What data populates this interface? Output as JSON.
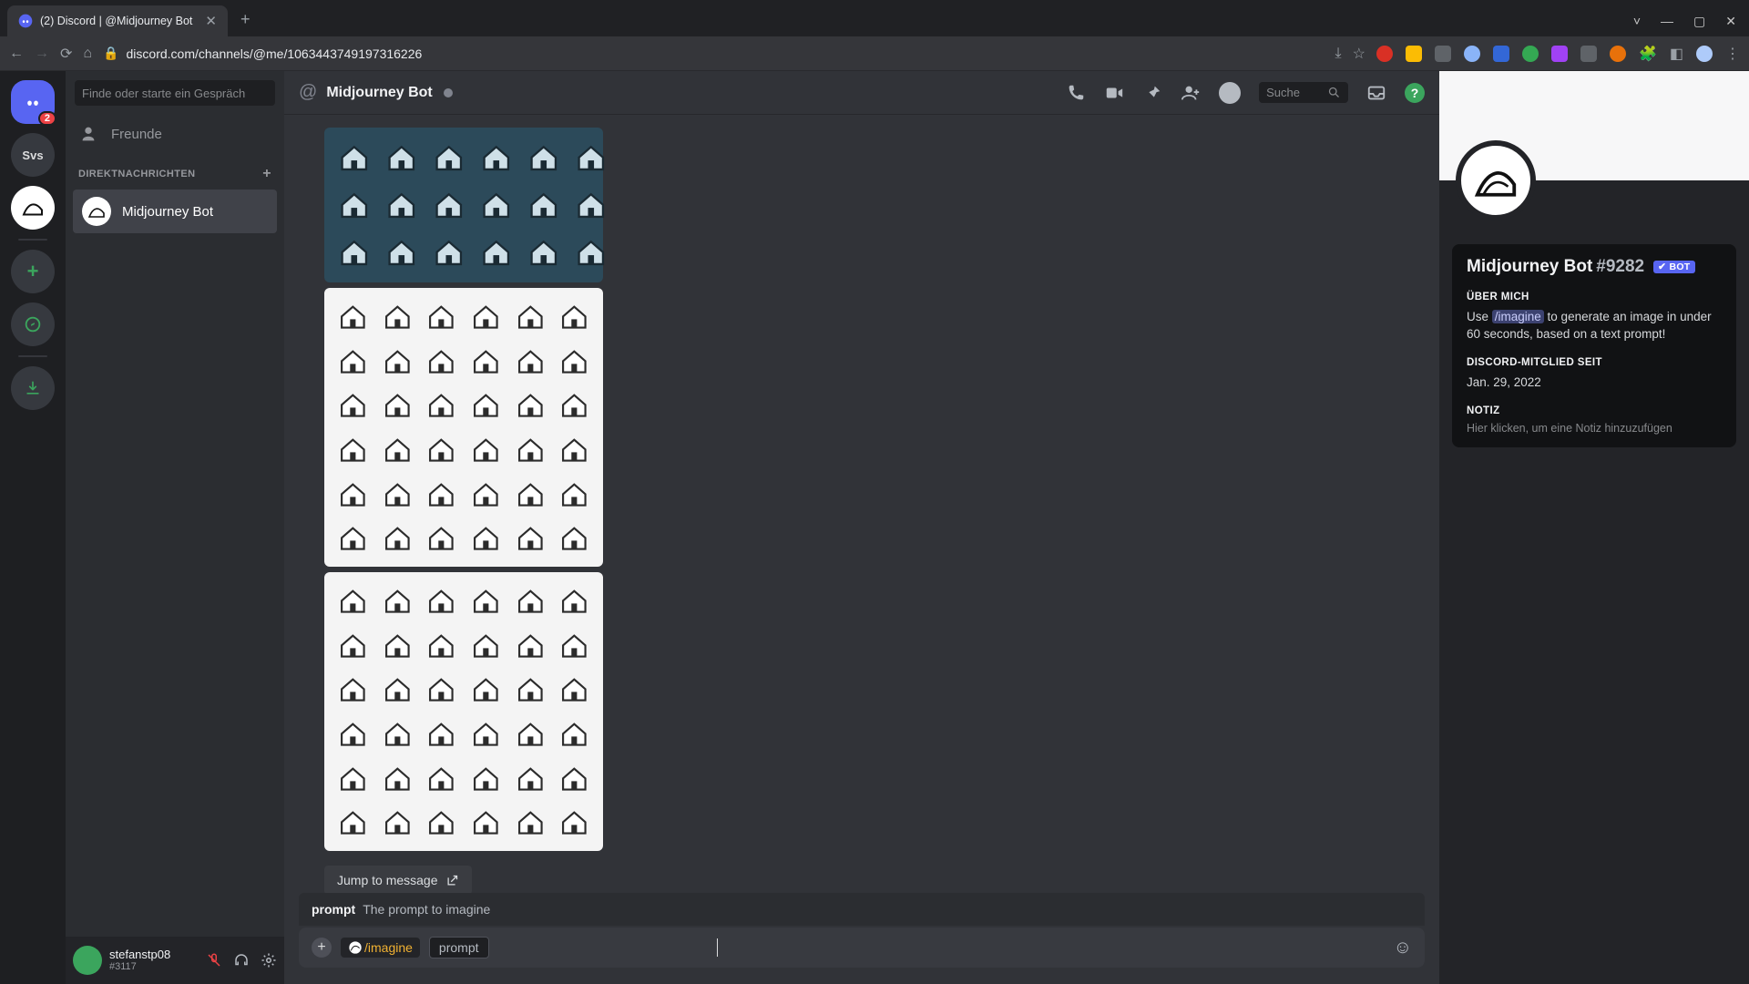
{
  "browser": {
    "tab_title": "(2) Discord | @Midjourney Bot",
    "url": "discord.com/channels/@me/1063443749197316226",
    "window_controls": {
      "min": "—",
      "max": "▢",
      "close": "✕"
    },
    "chevron": "˅",
    "ext_colors": [
      "#d93025",
      "#fbbc04",
      "#5f6368",
      "#8ab4f8",
      "#34a853",
      "#a142f4",
      "#e8710a",
      "#5f6368",
      "#5f6368",
      "#5f6368"
    ]
  },
  "guilds": {
    "home_badge": "2",
    "svs": "Svs"
  },
  "dm": {
    "find_placeholder": "Finde oder starte ein Gespräch",
    "friends": "Freunde",
    "header": "DIREKTNACHRICHTEN",
    "items": [
      {
        "label": "Midjourney Bot"
      }
    ]
  },
  "user": {
    "name": "stefanstp08",
    "tag": "#3117"
  },
  "channel": {
    "title": "Midjourney Bot",
    "search_placeholder": "Suche"
  },
  "chat": {
    "jump_label": "Jump to message",
    "hint_label": "prompt",
    "hint_desc": "The prompt to imagine",
    "command": "/imagine",
    "param": "prompt"
  },
  "profile": {
    "name": "Midjourney Bot",
    "discriminator": "#9282",
    "bot_badge": "✔ BOT",
    "about_h": "ÜBER MICH",
    "about_pre": "Use ",
    "about_cmd": "/imagine",
    "about_post": " to generate an image in under 60 seconds, based on a text prompt!",
    "member_h": "DISCORD-MITGLIED SEIT",
    "member_date": "Jan. 29, 2022",
    "note_h": "NOTIZ",
    "note_placeholder": "Hier klicken, um eine Notiz hinzuzufügen"
  }
}
